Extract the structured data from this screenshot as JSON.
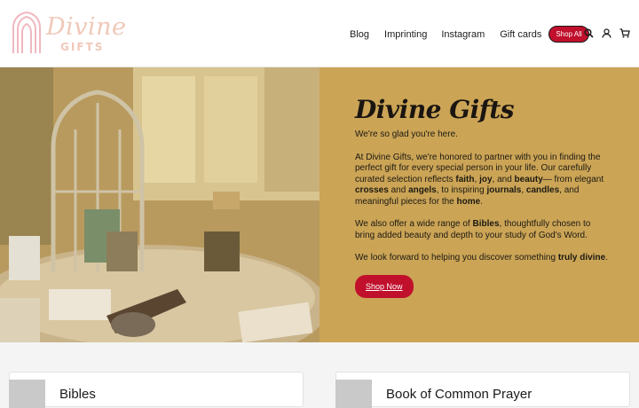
{
  "brand": {
    "name": "Divine",
    "sub": "GIFTS",
    "colors": {
      "logo": "#f0c8b8",
      "accent": "#c0102c",
      "hero_bg": "#cba456"
    }
  },
  "nav": {
    "items": [
      {
        "label": "Blog"
      },
      {
        "label": "Imprinting"
      },
      {
        "label": "Instagram"
      },
      {
        "label": "Gift cards"
      }
    ],
    "shop_all": "Shop All",
    "icons": [
      "search-icon",
      "account-icon",
      "cart-icon"
    ]
  },
  "hero": {
    "title": "Divine Gifts",
    "intro": "We're so glad you're here.",
    "p1": {
      "a": "At Divine Gifts, we're honored to partner with you in finding the perfect gift for every special person in your life. Our carefully curated selection reflects ",
      "faith": "faith",
      "b": ", ",
      "joy": "joy",
      "c": ", and ",
      "beauty": "beauty",
      "d": "— from elegant ",
      "crosses": "crosses",
      "e": " and ",
      "angels": "angels",
      "f": ", to inspiring ",
      "journals": "journals",
      "g": ", ",
      "candles": "candles",
      "h": ", and meaningful pieces for the ",
      "home": "home",
      "i": "."
    },
    "p2": {
      "a": "We also offer a wide range of ",
      "bibles": "Bibles",
      "b": ", thoughtfully chosen to bring added beauty and depth to your study of God's Word."
    },
    "p3": {
      "a": "We look forward to helping you discover something ",
      "truly_divine": "truly divine",
      "b": "."
    },
    "button": "Shop Now"
  },
  "cards": [
    {
      "title": "Bibles"
    },
    {
      "title": "Book of Common Prayer"
    }
  ]
}
